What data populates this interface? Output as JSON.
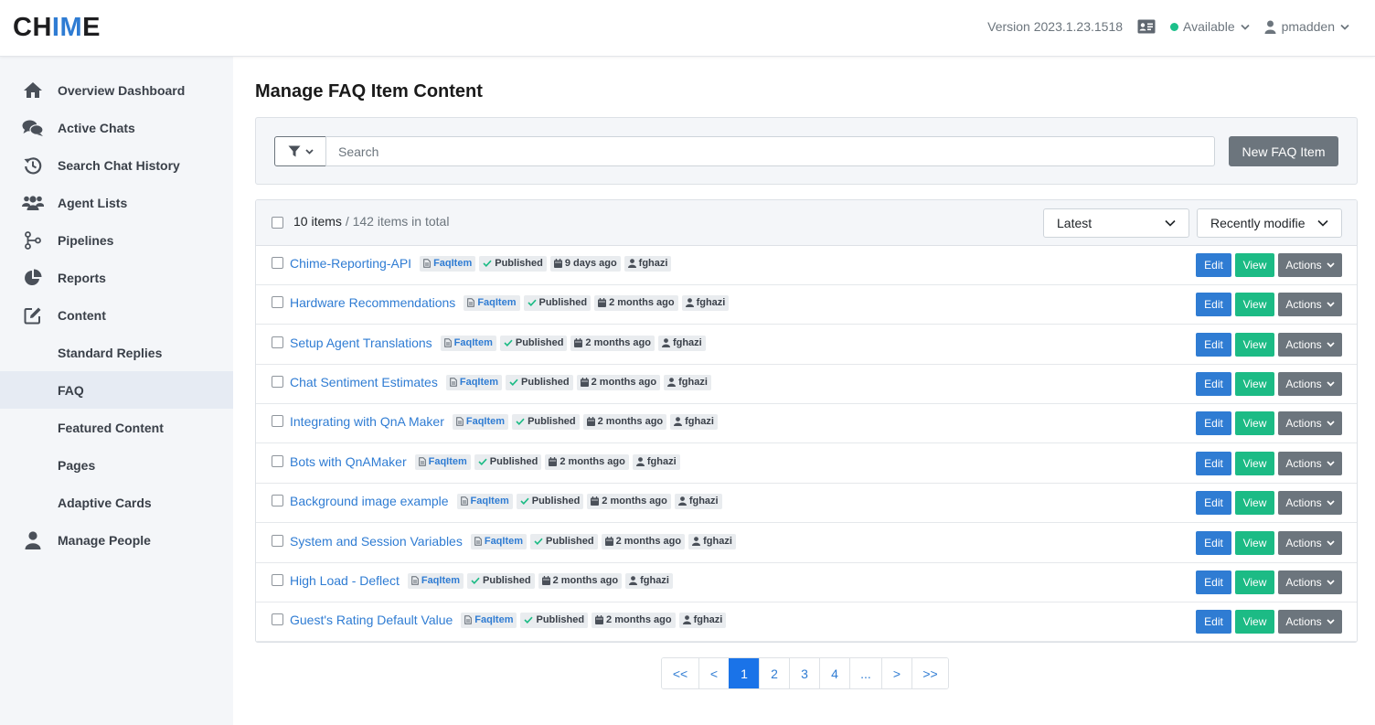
{
  "app": {
    "logo": {
      "part1": "CH",
      "part2": "IM",
      "part3": "E"
    },
    "version": "Version 2023.1.23.1518",
    "status": "Available",
    "username": "pmadden",
    "accent_color": "#2f7cd3"
  },
  "sidebar": {
    "items": [
      {
        "label": "Overview Dashboard",
        "icon": "home-icon"
      },
      {
        "label": "Active Chats",
        "icon": "chats-icon"
      },
      {
        "label": "Search Chat History",
        "icon": "history-icon"
      },
      {
        "label": "Agent Lists",
        "icon": "users-icon"
      },
      {
        "label": "Pipelines",
        "icon": "pipeline-icon"
      },
      {
        "label": "Reports",
        "icon": "pie-chart-icon"
      },
      {
        "label": "Content",
        "icon": "edit-icon"
      },
      {
        "label": "Standard Replies",
        "icon": ""
      },
      {
        "label": "FAQ",
        "icon": "",
        "active": true
      },
      {
        "label": "Featured Content",
        "icon": ""
      },
      {
        "label": "Pages",
        "icon": ""
      },
      {
        "label": "Adaptive Cards",
        "icon": ""
      },
      {
        "label": "Manage People",
        "icon": "user-icon"
      }
    ]
  },
  "main": {
    "title": "Manage FAQ Item Content",
    "search": {
      "placeholder": "Search",
      "value": ""
    },
    "new_button": "New FAQ Item",
    "list": {
      "count": "10 items",
      "total": "/ 142 items in total",
      "sort_primary": "Latest",
      "sort_secondary": "Recently modifie",
      "edit_label": "Edit",
      "view_label": "View",
      "actions_label": "Actions",
      "rows": [
        {
          "title": "Chime-Reporting-API",
          "type": "FaqItem",
          "status": "Published",
          "modified": "9 days ago",
          "author": "fghazi"
        },
        {
          "title": "Hardware Recommendations",
          "type": "FaqItem",
          "status": "Published",
          "modified": "2 months ago",
          "author": "fghazi"
        },
        {
          "title": "Setup Agent Translations",
          "type": "FaqItem",
          "status": "Published",
          "modified": "2 months ago",
          "author": "fghazi"
        },
        {
          "title": "Chat Sentiment Estimates",
          "type": "FaqItem",
          "status": "Published",
          "modified": "2 months ago",
          "author": "fghazi"
        },
        {
          "title": "Integrating with QnA Maker",
          "type": "FaqItem",
          "status": "Published",
          "modified": "2 months ago",
          "author": "fghazi"
        },
        {
          "title": "Bots with QnAMaker",
          "type": "FaqItem",
          "status": "Published",
          "modified": "2 months ago",
          "author": "fghazi"
        },
        {
          "title": "Background image example",
          "type": "FaqItem",
          "status": "Published",
          "modified": "2 months ago",
          "author": "fghazi"
        },
        {
          "title": "System and Session Variables",
          "type": "FaqItem",
          "status": "Published",
          "modified": "2 months ago",
          "author": "fghazi"
        },
        {
          "title": "High Load - Deflect",
          "type": "FaqItem",
          "status": "Published",
          "modified": "2 months ago",
          "author": "fghazi"
        },
        {
          "title": "Guest's Rating Default Value",
          "type": "FaqItem",
          "status": "Published",
          "modified": "2 months ago",
          "author": "fghazi"
        }
      ]
    },
    "pagination": {
      "items": [
        "<<",
        "<",
        "1",
        "2",
        "3",
        "4",
        "...",
        ">",
        ">>"
      ],
      "active": "1"
    }
  }
}
